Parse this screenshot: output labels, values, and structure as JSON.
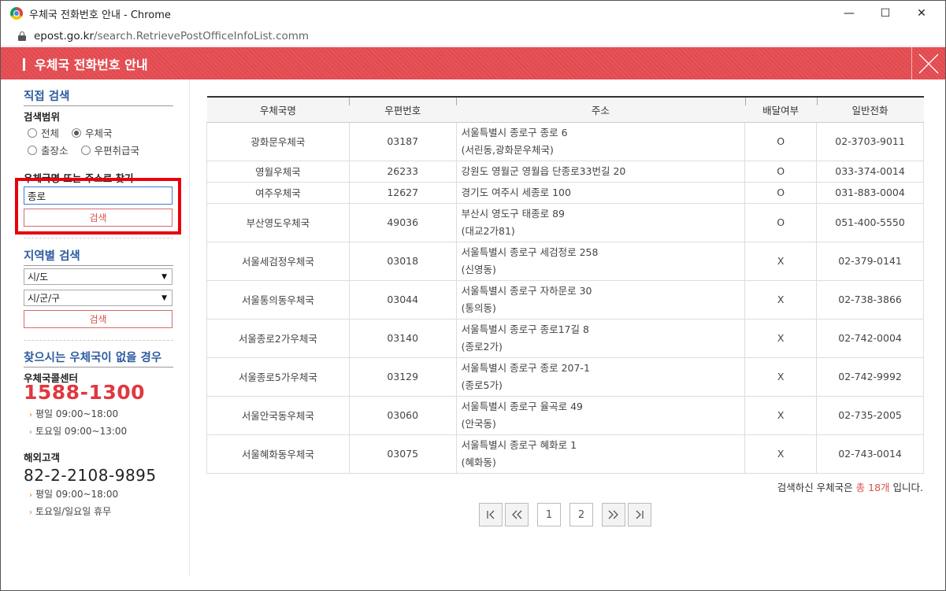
{
  "window": {
    "title": "우체국 전화번호 안내 - Chrome",
    "minimize": "—",
    "maximize": "☐",
    "close": "✕"
  },
  "address": {
    "host": "epost.go.kr",
    "path": "/search.RetrievePostOfficeInfoList.comm"
  },
  "header": {
    "title": "우체국 전화번호 안내"
  },
  "left": {
    "direct_search_title": "직접 검색",
    "scope_label": "검색범위",
    "radios_row1": [
      {
        "label": "전체",
        "selected": false
      },
      {
        "label": "우체국",
        "selected": true
      }
    ],
    "radios_row2": [
      {
        "label": "출장소",
        "selected": false
      },
      {
        "label": "우편취급국",
        "selected": false
      }
    ],
    "find_label": "우체국명 또는 주소로 찾기",
    "search_value": "종로",
    "search_button": "검색",
    "region_title": "지역별 검색",
    "select_sido": "시/도",
    "select_sigungu": "시/군/구",
    "region_button": "검색",
    "not_found_title": "찾으시는 우체국이 없을 경우",
    "callcenter_label": "우체국콜센터",
    "callcenter_phone": "1588-1300",
    "callcenter_hours": [
      "평일 09:00~18:00",
      "토요일 09:00~13:00"
    ],
    "overseas_label": "해외고객",
    "overseas_phone": "82-2-2108-9895",
    "overseas_hours": [
      "평일 09:00~18:00",
      "토요일/일요일 휴무"
    ]
  },
  "table": {
    "headers": [
      "우체국명",
      "우편번호",
      "주소",
      "배달여부",
      "일반전화"
    ],
    "rows": [
      {
        "name": "광화문우체국",
        "zip": "03187",
        "addr1": "서울특별시 종로구 종로 6",
        "addr2": "(서린동,광화문우체국)",
        "delivery": "O",
        "phone": "02-3703-9011"
      },
      {
        "name": "영월우체국",
        "zip": "26233",
        "addr1": "강원도 영월군 영월읍 단종로33번길 20",
        "addr2": "",
        "delivery": "O",
        "phone": "033-374-0014"
      },
      {
        "name": "여주우체국",
        "zip": "12627",
        "addr1": "경기도 여주시 세종로 100",
        "addr2": "",
        "delivery": "O",
        "phone": "031-883-0004"
      },
      {
        "name": "부산영도우체국",
        "zip": "49036",
        "addr1": "부산시 영도구 태종로 89",
        "addr2": "(대교2가81)",
        "delivery": "O",
        "phone": "051-400-5550"
      },
      {
        "name": "서울세검정우체국",
        "zip": "03018",
        "addr1": "서울특별시 종로구 세검정로 258",
        "addr2": "(신영동)",
        "delivery": "X",
        "phone": "02-379-0141"
      },
      {
        "name": "서울통의동우체국",
        "zip": "03044",
        "addr1": "서울특별시 종로구 자하문로 30",
        "addr2": "(통의동)",
        "delivery": "X",
        "phone": "02-738-3866"
      },
      {
        "name": "서울종로2가우체국",
        "zip": "03140",
        "addr1": "서울특별시 종로구 종로17길 8",
        "addr2": "(종로2가)",
        "delivery": "X",
        "phone": "02-742-0004"
      },
      {
        "name": "서울종로5가우체국",
        "zip": "03129",
        "addr1": "서울특별시 종로구 종로 207-1",
        "addr2": "(종로5가)",
        "delivery": "X",
        "phone": "02-742-9992"
      },
      {
        "name": "서울안국동우체국",
        "zip": "03060",
        "addr1": "서울특별시 종로구 율곡로 49",
        "addr2": "(안국동)",
        "delivery": "X",
        "phone": "02-735-2005"
      },
      {
        "name": "서울혜화동우체국",
        "zip": "03075",
        "addr1": "서울특별시 종로구 혜화로 1",
        "addr2": "(혜화동)",
        "delivery": "X",
        "phone": "02-743-0014"
      }
    ]
  },
  "result": {
    "prefix": "검색하신 우체국은 ",
    "count": "총 18개",
    "suffix": " 입니다."
  },
  "pager": {
    "first": "|<",
    "prev": "<<",
    "pages": [
      "1",
      "2"
    ],
    "next": ">>",
    "last": ">|"
  },
  "colors": {
    "header_red": "#e04a4f",
    "highlight_red": "#e8000d",
    "title_blue": "#2c5aa0",
    "phone_red": "#e0383f"
  }
}
